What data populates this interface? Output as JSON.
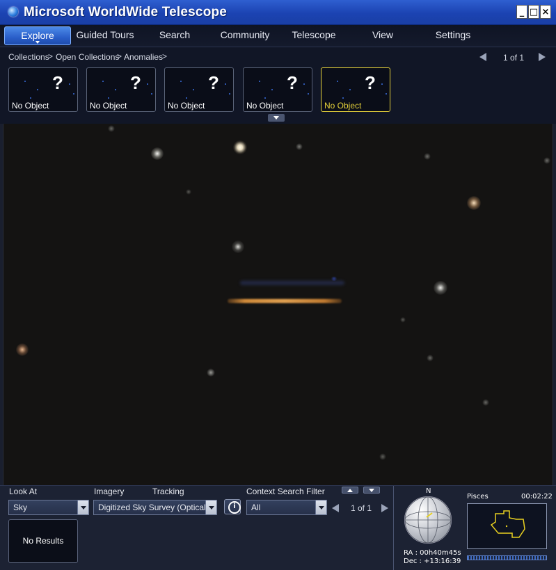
{
  "window": {
    "title": "Microsoft WorldWide Telescope",
    "minimize": "_",
    "maximize": "□",
    "close": "×"
  },
  "menu": {
    "items": [
      {
        "label": "Explore",
        "active": true
      },
      {
        "label": "Guided Tours"
      },
      {
        "label": "Search"
      },
      {
        "label": "Community"
      },
      {
        "label": "Telescope"
      },
      {
        "label": "View"
      },
      {
        "label": "Settings"
      }
    ]
  },
  "breadcrumb": {
    "items": [
      "Collections",
      "Open Collections",
      "Anomalies"
    ],
    "separator": ">",
    "page": "1 of 1"
  },
  "thumbnails": [
    {
      "label": "No Object",
      "glyph": "?",
      "selected": false
    },
    {
      "label": "No Object",
      "glyph": "?",
      "selected": false
    },
    {
      "label": "No Object",
      "glyph": "?",
      "selected": false
    },
    {
      "label": "No Object",
      "glyph": "?",
      "selected": false
    },
    {
      "label": "No Object",
      "glyph": "?",
      "selected": true
    }
  ],
  "bottom": {
    "look_at_label": "Look At",
    "look_at_value": "Sky",
    "imagery_label": "Imagery",
    "tracking_label": "Tracking",
    "imagery_value": "Digitized Sky Survey (Optical...",
    "context_label": "Context Search Filter",
    "context_value": "All",
    "context_page": "1 of 1",
    "results": "No Results",
    "compass_n": "N",
    "ra": "RA :  00h40m45s",
    "dec": "Dec :  +13:16:39",
    "constellation": "Pisces",
    "time": "00:02:22"
  },
  "colors": {
    "accent": "#2a5ec9",
    "selected_border": "#e6d23a",
    "sky": "#141312"
  }
}
